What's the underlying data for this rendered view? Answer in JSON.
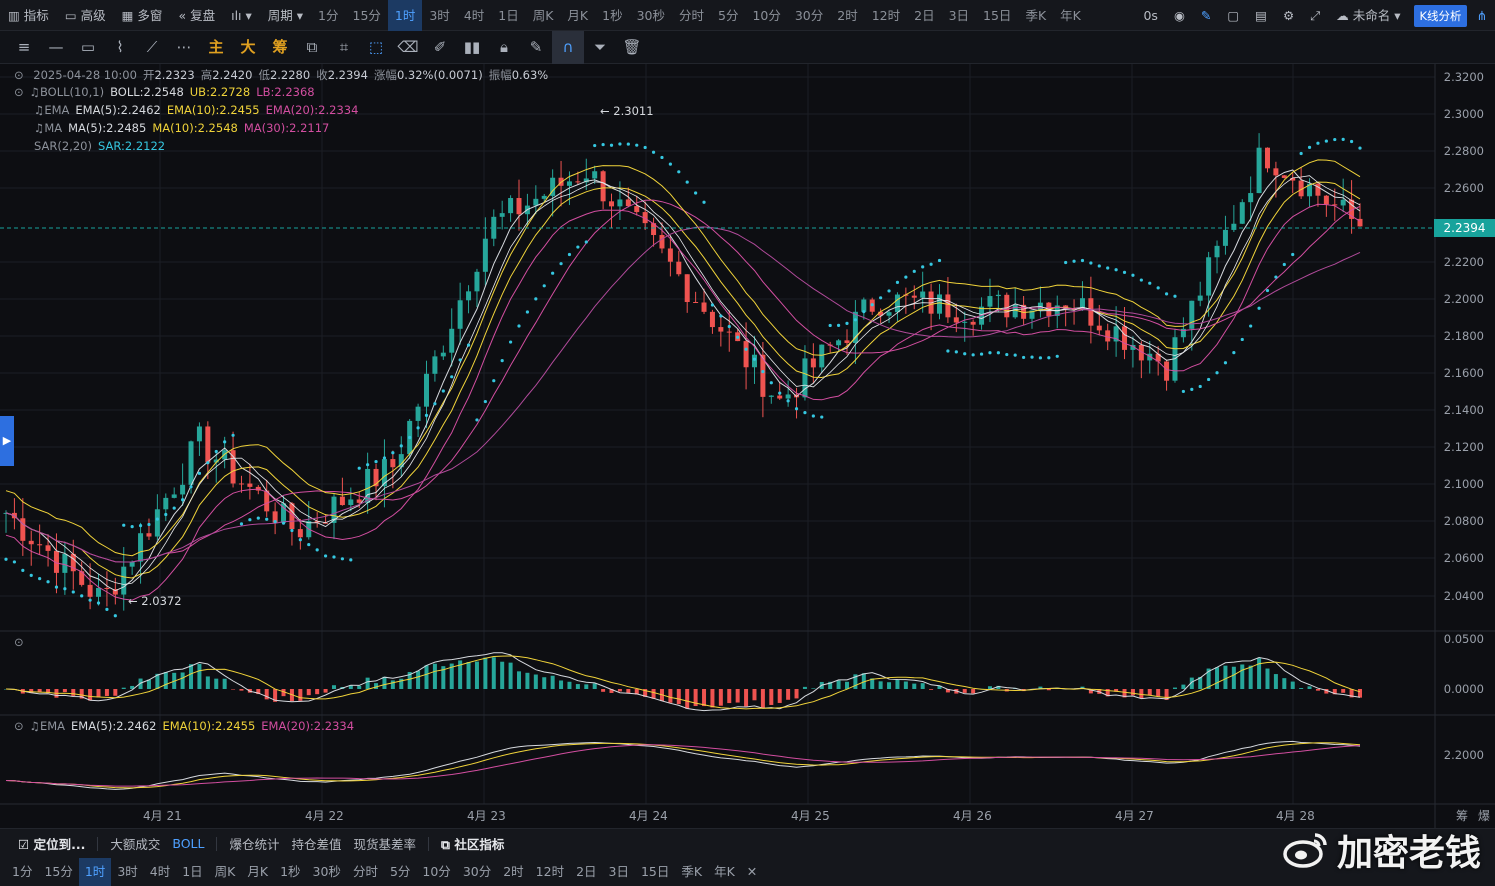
{
  "toolbar": {
    "indicator": "指标",
    "advanced": "高级",
    "multi_window": "多窗",
    "replay": "复盘",
    "period": "周期",
    "periods": [
      "1分",
      "15分",
      "1时",
      "3时",
      "4时",
      "1日",
      "周K",
      "月K",
      "1秒",
      "30秒",
      "分时",
      "5分",
      "10分",
      "30分",
      "2时",
      "12时",
      "2日",
      "3日",
      "15日",
      "季K",
      "年K"
    ],
    "active_period": "1时",
    "latency": "0s",
    "layout_name": "未命名",
    "kline_analysis": "K线分析"
  },
  "drawing_toolbar": {
    "main": "主",
    "big": "大",
    "chips": "筹"
  },
  "legend": {
    "ohlc": {
      "time": "2025-04-28 10:00",
      "open_label": "开",
      "open": "2.2323",
      "high_label": "高",
      "high": "2.2420",
      "low_label": "低",
      "low": "2.2280",
      "close_label": "收",
      "close": "2.2394",
      "change_label": "涨幅",
      "change": "0.32%(0.0071)",
      "amp_label": "振幅",
      "amp": "0.63%"
    },
    "boll": {
      "name": "BOLL(10,1)",
      "mid": "BOLL:2.2548",
      "ub": "UB:2.2728",
      "lb": "LB:2.2368"
    },
    "ema": {
      "name": "EMA",
      "e5": "EMA(5):2.2462",
      "e10": "EMA(10):2.2455",
      "e20": "EMA(20):2.2334"
    },
    "ma": {
      "name": "MA",
      "m5": "MA(5):2.2485",
      "m10": "MA(10):2.2548",
      "m30": "MA(30):2.2117"
    },
    "sar": {
      "name": "SAR(2,20)",
      "val": "SAR:2.2122"
    }
  },
  "sub_legend": {
    "ema": {
      "name": "EMA",
      "e5": "EMA(5):2.2462",
      "e10": "EMA(10):2.2455",
      "e20": "EMA(20):2.2334"
    }
  },
  "annotations": {
    "high": "← 2.3011",
    "low": "← 2.0372"
  },
  "y_axis_main": [
    "2.3200",
    "2.3000",
    "2.2800",
    "2.2600",
    "2.2200",
    "2.2000",
    "2.1800",
    "2.1600",
    "2.1400",
    "2.1200",
    "2.1000",
    "2.0800",
    "2.0600",
    "2.0400"
  ],
  "current_price": "2.2394",
  "y_axis_macd": [
    "0.0500",
    "0.0000"
  ],
  "y_axis_ema": [
    "2.2000"
  ],
  "x_axis": [
    "4月 21",
    "4月 22",
    "4月 23",
    "4月 24",
    "4月 25",
    "4月 26",
    "4月 27",
    "4月 28"
  ],
  "footer": {
    "locate": "定位到...",
    "big_trades": "大额成交",
    "boll": "BOLL",
    "liquidation": "爆仓统计",
    "oi_diff": "持仓差值",
    "basis": "现货基差率",
    "community": "社区指标",
    "right1": "筹",
    "right2": "爆"
  },
  "bottom_periods": [
    "1分",
    "15分",
    "1时",
    "3时",
    "4时",
    "1日",
    "周K",
    "月K",
    "1秒",
    "30秒",
    "分时",
    "5分",
    "10分",
    "30分",
    "2时",
    "12时",
    "2日",
    "3日",
    "15日",
    "季K",
    "年K"
  ],
  "bottom_active": "1时",
  "watermark": "加密老钱",
  "colors": {
    "up": "#26a69a",
    "down": "#ef5350",
    "accent": "#2d6fe0",
    "ema10": "#f0d33a",
    "ema20": "#d24ea0",
    "sar": "#35c7e0"
  },
  "chart_data": {
    "type": "candlestick",
    "interval": "1时",
    "y_range": [
      2.03,
      2.32
    ],
    "key_levels": {
      "high": 2.3011,
      "low": 2.0372,
      "last": 2.2394
    },
    "approx_close_path": [
      {
        "x": "4月 21",
        "y": 2.085
      },
      {
        "x": "4月 21 (low)",
        "y": 2.0372
      },
      {
        "x": "4月 22",
        "y": 2.123
      },
      {
        "x": "4月 22 (late)",
        "y": 2.075
      },
      {
        "x": "4月 23",
        "y": 2.11
      },
      {
        "x": "4月 23 (late)",
        "y": 2.24
      },
      {
        "x": "4月 24",
        "y": 2.27
      },
      {
        "x": "4月 24 (late)",
        "y": 2.21
      },
      {
        "x": "4月 25",
        "y": 2.145
      },
      {
        "x": "4月 25 (late)",
        "y": 2.2
      },
      {
        "x": "4月 26",
        "y": 2.195
      },
      {
        "x": "4月 27",
        "y": 2.2
      },
      {
        "x": "4月 27 (late)",
        "y": 2.165
      },
      {
        "x": "4月 28",
        "y": 2.28
      },
      {
        "x": "4月 28 (last)",
        "y": 2.2394
      }
    ]
  }
}
